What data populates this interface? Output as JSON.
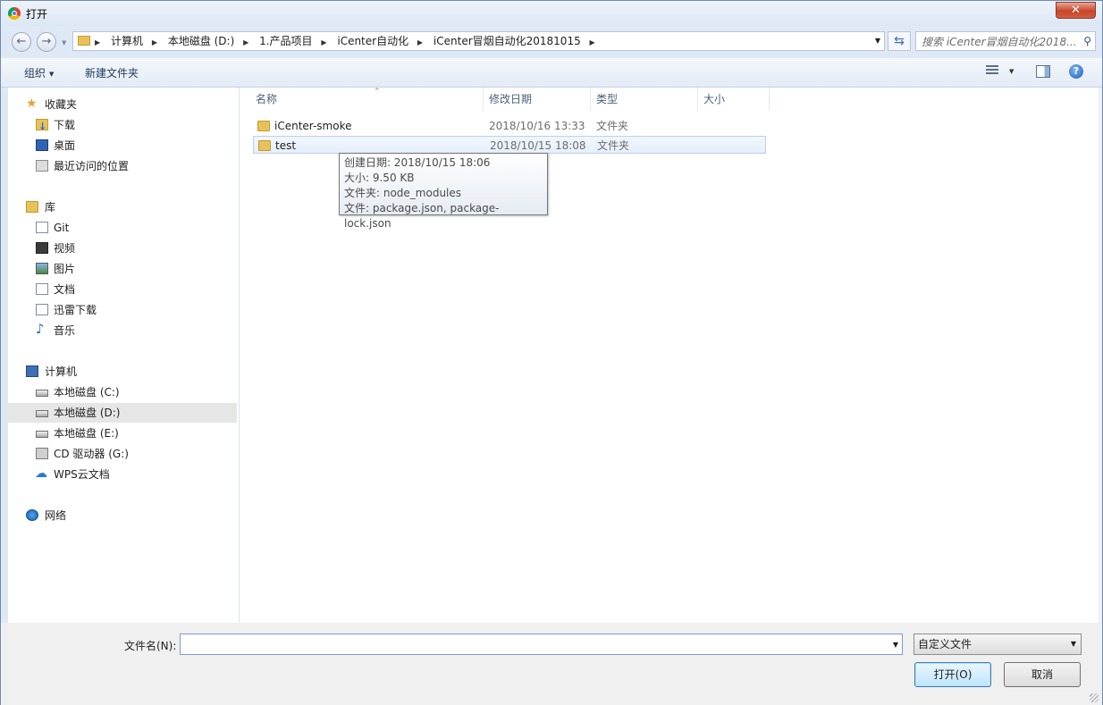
{
  "window": {
    "title": "打开",
    "close_label": "✕"
  },
  "nav": {
    "back_glyph": "←",
    "forward_glyph": "→",
    "breadcrumb": [
      "计算机",
      "本地磁盘 (D:)",
      "1.产品项目",
      "iCenter自动化",
      "iCenter冒烟自动化20181015"
    ],
    "search_placeholder": "搜索 iCenter冒烟自动化2018..."
  },
  "toolbar": {
    "organize_label": "组织",
    "new_folder_label": "新建文件夹",
    "help_glyph": "?"
  },
  "sidebar": {
    "favorites": {
      "label": "收藏夹",
      "items": [
        "下载",
        "桌面",
        "最近访问的位置"
      ]
    },
    "libraries": {
      "label": "库",
      "items": [
        "Git",
        "视频",
        "图片",
        "文档",
        "迅雷下载",
        "音乐"
      ]
    },
    "computer": {
      "label": "计算机",
      "items": [
        "本地磁盘 (C:)",
        "本地磁盘 (D:)",
        "本地磁盘 (E:)",
        "CD 驱动器 (G:)",
        "WPS云文档"
      ]
    },
    "network": {
      "label": "网络"
    }
  },
  "columns": {
    "name": "名称",
    "modified": "修改日期",
    "type": "类型",
    "size": "大小"
  },
  "files": [
    {
      "name": "iCenter-smoke",
      "modified": "2018/10/16 13:33",
      "type": "文件夹"
    },
    {
      "name": "test",
      "modified": "2018/10/15 18:08",
      "type": "文件夹"
    }
  ],
  "tooltip": [
    "创建日期: 2018/10/15 18:06",
    "大小: 9.50 KB",
    "文件夹: node_modules",
    "文件: package.json, package-lock.json"
  ],
  "footer": {
    "filename_label": "文件名(N):",
    "filename_value": "",
    "filetype_value": "自定义文件",
    "open_label": "打开(O)",
    "cancel_label": "取消"
  }
}
